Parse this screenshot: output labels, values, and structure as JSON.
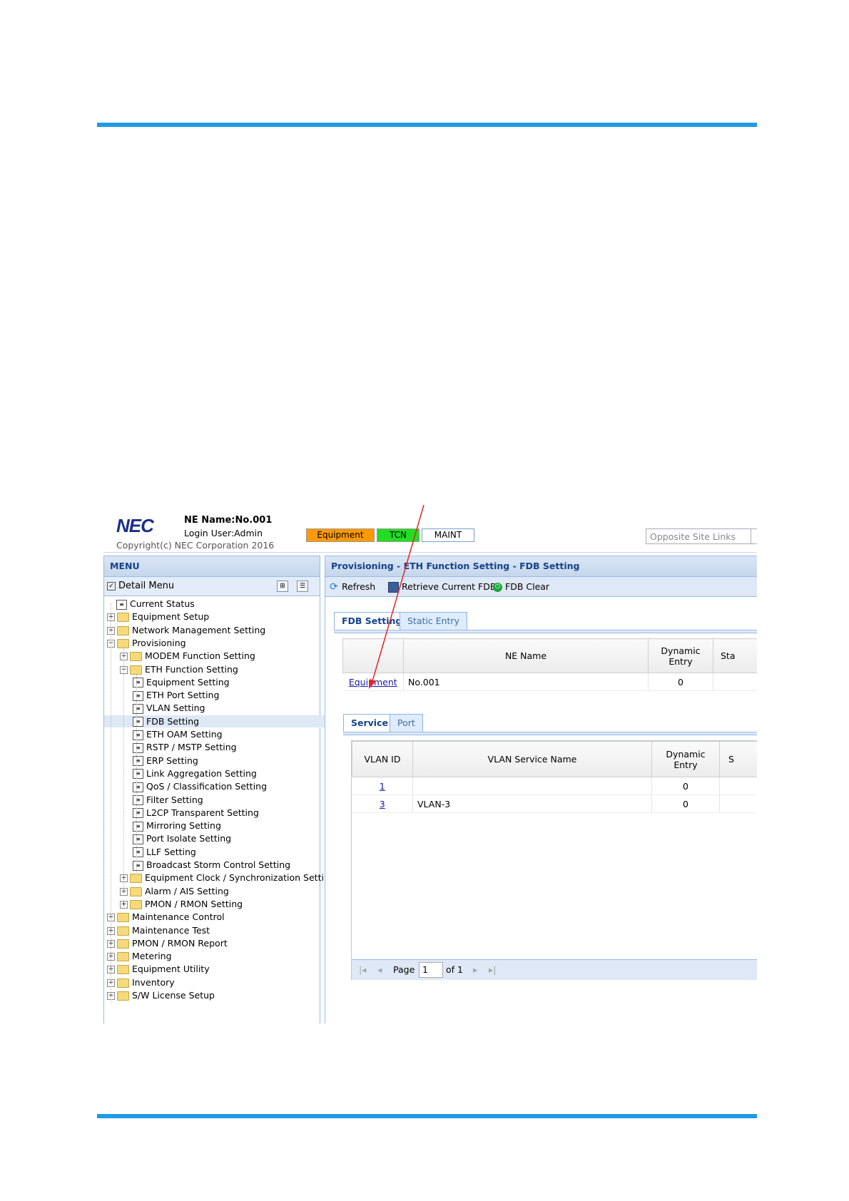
{
  "header": {
    "logo": "NEC",
    "ne_name": "NE Name:No.001",
    "login_user": "Login User:Admin",
    "copyright": "Copyright(c) NEC Corporation 2016"
  },
  "status_badges": [
    {
      "label": "Equipment",
      "color": "#ff9900"
    },
    {
      "label": "TCN",
      "color": "#22dd22"
    },
    {
      "label": "MAINT",
      "color": "#ffffff"
    }
  ],
  "opposite_site": {
    "placeholder": "Opposite Site Links"
  },
  "menu": {
    "title": "MENU",
    "detail_menu": "Detail Menu",
    "detail_checked": true
  },
  "tree": [
    {
      "label": "Current Status",
      "level": 0,
      "type": "leaf"
    },
    {
      "label": "Equipment Setup",
      "level": 0,
      "type": "folder"
    },
    {
      "label": "Network Management Setting",
      "level": 0,
      "type": "folder"
    },
    {
      "label": "Provisioning",
      "level": 0,
      "type": "folder",
      "expanded": true
    },
    {
      "label": "MODEM Function Setting",
      "level": 1,
      "type": "folder"
    },
    {
      "label": "ETH Function Setting",
      "level": 1,
      "type": "folder",
      "expanded": true
    },
    {
      "label": "Equipment Setting",
      "level": 2,
      "type": "leaf"
    },
    {
      "label": "ETH Port Setting",
      "level": 2,
      "type": "leaf"
    },
    {
      "label": "VLAN Setting",
      "level": 2,
      "type": "leaf"
    },
    {
      "label": "FDB Setting",
      "level": 2,
      "type": "leaf",
      "selected": true
    },
    {
      "label": "ETH OAM Setting",
      "level": 2,
      "type": "leaf"
    },
    {
      "label": "RSTP / MSTP Setting",
      "level": 2,
      "type": "leaf"
    },
    {
      "label": "ERP Setting",
      "level": 2,
      "type": "leaf"
    },
    {
      "label": "Link Aggregation Setting",
      "level": 2,
      "type": "leaf"
    },
    {
      "label": "QoS / Classification Setting",
      "level": 2,
      "type": "leaf"
    },
    {
      "label": "Filter Setting",
      "level": 2,
      "type": "leaf"
    },
    {
      "label": "L2CP Transparent Setting",
      "level": 2,
      "type": "leaf"
    },
    {
      "label": "Mirroring Setting",
      "level": 2,
      "type": "leaf"
    },
    {
      "label": "Port Isolate Setting",
      "level": 2,
      "type": "leaf"
    },
    {
      "label": "LLF Setting",
      "level": 2,
      "type": "leaf"
    },
    {
      "label": "Broadcast Storm Control Setting",
      "level": 2,
      "type": "leaf"
    },
    {
      "label": "Equipment Clock / Synchronization Setting",
      "level": 1,
      "type": "folder"
    },
    {
      "label": "Alarm / AIS Setting",
      "level": 1,
      "type": "folder"
    },
    {
      "label": "PMON / RMON Setting",
      "level": 1,
      "type": "folder"
    },
    {
      "label": "Maintenance Control",
      "level": 0,
      "type": "folder"
    },
    {
      "label": "Maintenance Test",
      "level": 0,
      "type": "folder"
    },
    {
      "label": "PMON / RMON Report",
      "level": 0,
      "type": "folder"
    },
    {
      "label": "Metering",
      "level": 0,
      "type": "folder"
    },
    {
      "label": "Equipment Utility",
      "level": 0,
      "type": "folder"
    },
    {
      "label": "Inventory",
      "level": 0,
      "type": "folder"
    },
    {
      "label": "S/W License Setup",
      "level": 0,
      "type": "folder"
    }
  ],
  "main": {
    "breadcrumb": "Provisioning - ETH Function Setting - FDB Setting",
    "toolbar": {
      "refresh": "Refresh",
      "retrieve": "Retrieve Current FDB",
      "clear": "FDB Clear"
    },
    "tabs": [
      "FDB Setting",
      "Static Entry"
    ],
    "ne_table": {
      "headers": [
        "",
        "NE Name",
        "Dynamic Entry",
        "Sta"
      ],
      "rows": [
        {
          "link": "Equipment",
          "name": "No.001",
          "dynamic": "0"
        }
      ]
    },
    "sub_tabs": [
      "Service",
      "Port"
    ],
    "vlan_table": {
      "headers": [
        "VLAN ID",
        "VLAN Service Name",
        "Dynamic Entry",
        "S"
      ],
      "rows": [
        {
          "id": "1",
          "name": "",
          "dynamic": "0"
        },
        {
          "id": "3",
          "name": "VLAN-3",
          "dynamic": "0"
        }
      ]
    },
    "pager": {
      "page_label": "Page",
      "page": "1",
      "of": "of 1"
    }
  }
}
